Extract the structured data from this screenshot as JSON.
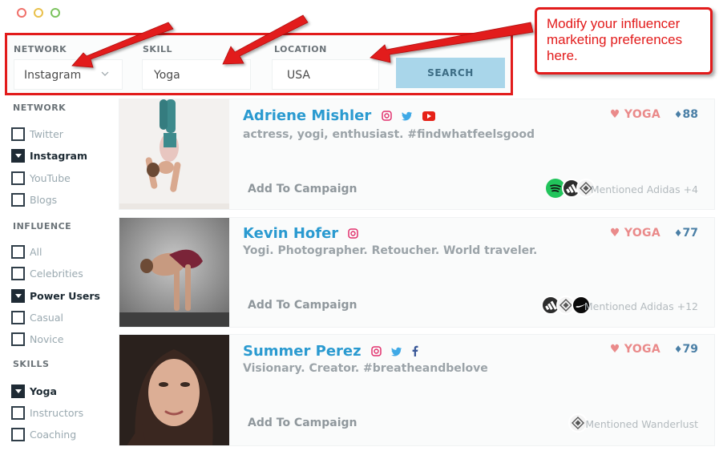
{
  "window": {
    "buttons": [
      "close",
      "minimize",
      "maximize"
    ]
  },
  "search": {
    "network": {
      "label": "NETWORK",
      "value": "Instagram"
    },
    "skill": {
      "label": "SKILL",
      "value": "Yoga"
    },
    "location": {
      "label": "LOCATION",
      "value": "USA"
    },
    "button": "SEARCH"
  },
  "callout": {
    "line1": "Modify your influencer",
    "line2": "marketing preferences",
    "line3": "here."
  },
  "filters": {
    "network": {
      "title": "NETWORK",
      "items": [
        {
          "label": "Twitter",
          "checked": false
        },
        {
          "label": "Instagram",
          "checked": true
        },
        {
          "label": "YouTube",
          "checked": false
        },
        {
          "label": "Blogs",
          "checked": false
        }
      ]
    },
    "influence": {
      "title": "INFLUENCE",
      "items": [
        {
          "label": "All",
          "checked": false
        },
        {
          "label": "Celebrities",
          "checked": false
        },
        {
          "label": "Power Users",
          "checked": true
        },
        {
          "label": "Casual",
          "checked": false
        },
        {
          "label": "Novice",
          "checked": false
        }
      ]
    },
    "skills": {
      "title": "SKILLS",
      "items": [
        {
          "label": "Yoga",
          "checked": true
        },
        {
          "label": "Instructors",
          "checked": false
        },
        {
          "label": "Coaching",
          "checked": false
        }
      ]
    }
  },
  "influencers": [
    {
      "name": "Adriene Mishler",
      "bio": "actress, yogi, enthusiast. #findwhatfeelsgood",
      "networks": [
        "instagram-icon",
        "twitter-icon",
        "youtube-icon"
      ],
      "skill": "YOGA",
      "score": "88",
      "add_label": "Add To Campaign",
      "mention": "Mentioned Adidas +4",
      "brands": [
        "spotify",
        "adidas",
        "brand-seal"
      ]
    },
    {
      "name": "Kevin Hofer",
      "bio": "Yogi. Photographer. Retoucher. World traveler.",
      "networks": [
        "instagram-icon"
      ],
      "skill": "YOGA",
      "score": "77",
      "add_label": "Add To Campaign",
      "mention": "Mentioned Adidas +12",
      "brands": [
        "adidas",
        "brand-seal",
        "nike"
      ]
    },
    {
      "name": "Summer Perez",
      "bio": "Visionary. Creator. #breatheandbelove",
      "networks": [
        "instagram-icon",
        "twitter-icon",
        "facebook-icon"
      ],
      "skill": "YOGA",
      "score": "79",
      "add_label": "Add To Campaign",
      "mention": "Mentioned Wanderlust",
      "brands": [
        "wanderlust-seal"
      ]
    }
  ],
  "colors": {
    "accent_blue": "#2a9ad0",
    "annotation_red": "#e21b1b",
    "search_button": "#a9d6ea",
    "skill_pink": "#ea8a8a"
  }
}
